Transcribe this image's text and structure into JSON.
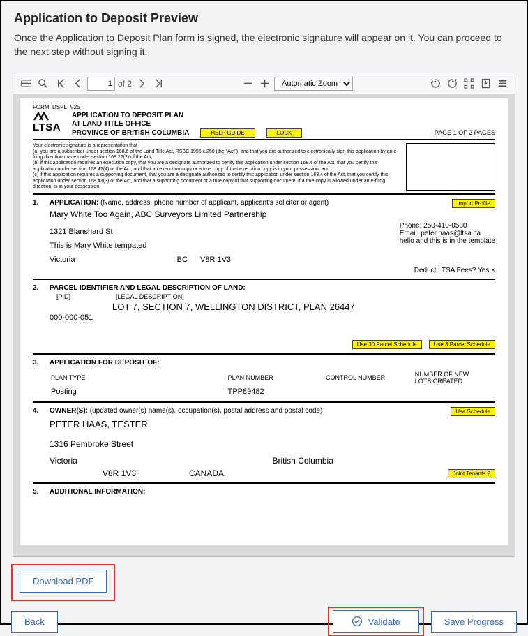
{
  "header": {
    "title": "Application to Deposit Preview",
    "subtitle": "Once the Application to Deposit Plan form is signed, the electronic signature will appear on it. You can proceed to the next step without signing it."
  },
  "toolbar": {
    "page_input": "1",
    "page_total": "of 2",
    "zoom_mode": "Automatic Zoom"
  },
  "form": {
    "form_id": "FORM_DSPL_V25",
    "logo_text": "LTSA",
    "title1": "APPLICATION TO DEPOSIT PLAN",
    "title2": "AT LAND TITLE OFFICE",
    "title3": "PROVINCE OF BRITISH COLUMBIA",
    "help_guide": "HELP GUIDE",
    "lock": "LOCK",
    "page_ind": "PAGE   1   OF   2   PAGES",
    "sig_intro": "Your electronic signature is a representation that",
    "sig_a": "(a)   you are a subscriber under section 168.6 of the Land Title Act, RSBC 1996 c.250 (the \"Act\"), and that you are authorized to electronically sign this application by an e-filing direction made under section 168.22(2) of the Act,",
    "sig_b": "(b)   if this application requires an execution copy, that you are a designate authorized to certify this application under section 168.4 of the Act, that you certify this application under section 168.42(4) of the Act, and that an execution copy or a true copy of that execution copy is in your possession, and",
    "sig_c": "(c)   if this application requires a supporting document, that you are a designate authorized to certify this application under section 168.4 of the Act, that you certify this application under section 168.43(3) of the Act, and that a supporting document or a true copy of that supporting document, if a true copy is allowed under an e-filing direction, is in your possession.",
    "s1": {
      "num": "1.",
      "label": "APPLICATION:",
      "hint": "(Name, address, phone number of applicant, applicant's solicitor or agent)",
      "import": "Import Profile",
      "name": "Mary White Too Again, ABC Surveyors Limited Partnership",
      "addr1": "1321 Blanshard St",
      "addr2": "This is Mary White tempated",
      "city": "Victoria",
      "prov": "BC",
      "postal": "V8R 1V3",
      "phone": "Phone: 250-410-0580",
      "email": "Email: peter.haas@ltsa.ca",
      "note": "hello and this is in the template",
      "deduct": "Deduct LTSA Fees?  Yes ×"
    },
    "s2": {
      "num": "2.",
      "label": "PARCEL IDENTIFIER AND LEGAL DESCRIPTION OF LAND:",
      "pid_h": "[PID]",
      "legal_h": "[LEGAL DESCRIPTION]",
      "legal": "LOT 7, SECTION 7, WELLINGTON DISTRICT, PLAN 26447",
      "pid": "000-000-051",
      "btn30": "Use 30 Parcel Schedule",
      "btn3": "Use 3 Parcel Schedule"
    },
    "s3": {
      "num": "3.",
      "label": "APPLICATION FOR DEPOSIT OF:",
      "h1": "PLAN TYPE",
      "h2": "PLAN NUMBER",
      "h3": "CONTROL NUMBER",
      "h4a": "NUMBER OF NEW",
      "h4b": "LOTS CREATED",
      "v1": "Posting",
      "v2": "TPP89482"
    },
    "s4": {
      "num": "4.",
      "label": "OWNER(S):",
      "hint": "(updated owner(s) name(s), occupation(s), postal address and postal code)",
      "use_sched": "Use Schedule",
      "name": "PETER HAAS, TESTER",
      "addr": "1316 Pembroke Street",
      "city": "Victoria",
      "prov": "British Columbia",
      "postal": "V8R 1V3",
      "country": "CANADA",
      "joint": "Joint Tenants ?"
    },
    "s5": {
      "num": "5.",
      "label": "ADDITIONAL INFORMATION:"
    }
  },
  "buttons": {
    "download": "Download PDF",
    "back": "Back",
    "validate": "Validate",
    "save": "Save Progress"
  }
}
